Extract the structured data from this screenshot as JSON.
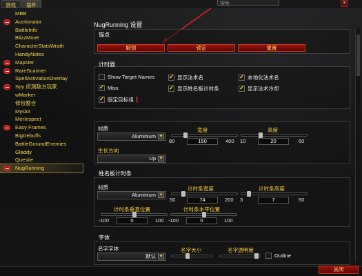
{
  "tabs": {
    "game": "游戏",
    "addons": "插件"
  },
  "search": {
    "placeholder": "搜索"
  },
  "close_x": "×",
  "sidebar": {
    "items": [
      {
        "label": "MBB",
        "toggle": false
      },
      {
        "label": "Auctionator",
        "toggle": true
      },
      {
        "label": "BattleInfo",
        "toggle": false
      },
      {
        "label": "BlizzMove",
        "toggle": false
      },
      {
        "label": "CharacterStatsWrath",
        "toggle": false
      },
      {
        "label": "HandyNotes",
        "toggle": false
      },
      {
        "label": "Mapster",
        "toggle": true
      },
      {
        "label": "RareScanner",
        "toggle": true
      },
      {
        "label": "SpellActivationOverlay",
        "toggle": false
      },
      {
        "label": "Spy 侦测敌方玩家",
        "toggle": true
      },
      {
        "label": "wMarker",
        "toggle": false
      },
      {
        "label": "修包整合",
        "toggle": false
      },
      {
        "label": "Myslot",
        "toggle": false
      },
      {
        "label": "MerInspect",
        "toggle": false
      },
      {
        "label": "Easy Frames",
        "toggle": true
      },
      {
        "label": "BigDebuffs",
        "toggle": false
      },
      {
        "label": "BattleGroundEnemies",
        "toggle": false
      },
      {
        "label": "Gladdy",
        "toggle": false
      },
      {
        "label": "Questie",
        "toggle": false
      },
      {
        "label": "NugRunning",
        "toggle": true,
        "selected": true
      }
    ]
  },
  "panel": {
    "title": "NugRunning 设置",
    "anchor": {
      "title": "锚点",
      "unlock": "解锁",
      "lock": "锁定",
      "reset": "重置"
    },
    "timers": {
      "title": "计时器",
      "options": [
        {
          "label": "Show Target Names",
          "checked": false
        },
        {
          "label": "显示法术名",
          "checked": true
        },
        {
          "label": "本地化法术名",
          "checked": true
        },
        {
          "label": "Miss",
          "checked": true
        },
        {
          "label": "显示姓名板计时条",
          "checked": true
        },
        {
          "label": "显示法术冷却",
          "checked": true
        },
        {
          "label": "固定目标组❗",
          "checked": true
        }
      ]
    },
    "general": {
      "texture_label": "材质",
      "texture_value": "Aluminium",
      "width_label": "宽度",
      "width_min": "80",
      "width_value": "150",
      "width_max": "400",
      "height_label": "高度",
      "height_min": "10",
      "height_value": "20",
      "height_max": "50",
      "growth_label": "生长方向",
      "growth_value": "Up"
    },
    "nameplate": {
      "title": "姓名板计时条",
      "texture_label": "材质",
      "texture_value": "Aluminium",
      "width_label": "计时条宽度",
      "width_min": "50",
      "width_value": "74",
      "width_max": "200",
      "height_label": "计时条高度",
      "height_min": "3",
      "height_value": "7",
      "height_max": "50",
      "voffset_label": "计时条垂直位置",
      "voffset_min": "-100",
      "voffset_value": "0",
      "voffset_max": "100",
      "hoffset_label": "计时条水平位置",
      "hoffset_min": "-100",
      "hoffset_value": "0",
      "hoffset_max": "100"
    },
    "font": {
      "title": "字体",
      "name_font_label": "名字字体",
      "name_font_value": "默认",
      "name_size_label": "名字大小",
      "name_alpha_label": "名字透明度",
      "outline_label": "Outline"
    }
  },
  "footer": {
    "close": "关闭"
  }
}
